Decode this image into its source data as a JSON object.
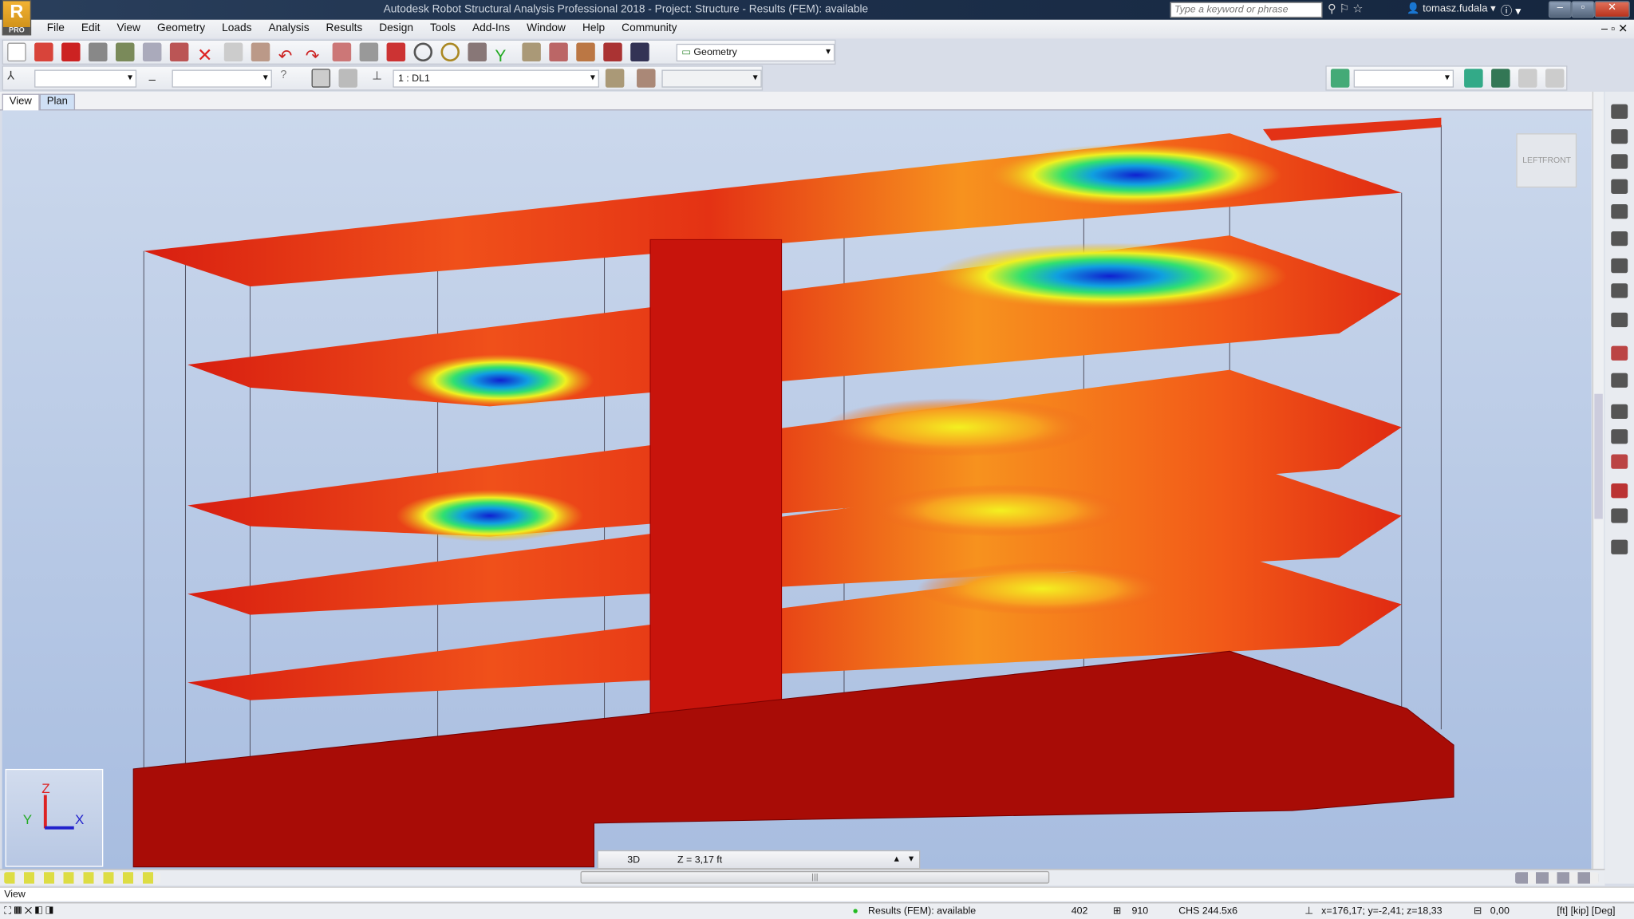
{
  "app": {
    "title": "Autodesk Robot Structural Analysis Professional 2018 - Project: Structure - Results (FEM): available",
    "logo_text": "R",
    "logo_badge": "PRO"
  },
  "search": {
    "placeholder": "Type a keyword or phrase"
  },
  "user": {
    "name": "tomasz.fudala"
  },
  "menu": [
    "File",
    "Edit",
    "View",
    "Geometry",
    "Loads",
    "Analysis",
    "Results",
    "Design",
    "Tools",
    "Add-Ins",
    "Window",
    "Help",
    "Community"
  ],
  "toolbar": {
    "layout_select": "Geometry",
    "load_case": "1 : DL1"
  },
  "tabs": [
    "View",
    "Plan"
  ],
  "viewcube": {
    "left": "LEFT",
    "front": "FRONT"
  },
  "axes": {
    "z": "Z",
    "y": "Y",
    "x": "X"
  },
  "view_controls": {
    "mode": "3D",
    "level": "Z = 3,17 ft"
  },
  "view_line": "View",
  "status": {
    "results": "Results (FEM): available",
    "nodes": "402",
    "bars": "910",
    "section": "CHS 244.5x6",
    "coords": "x=176,17; y=-2,41; z=18,33",
    "angle": "0,00",
    "units": "[ft] [kip] [Deg]"
  },
  "colors": {
    "accent": "#c81a0f",
    "title_bar": "#1c2f4a",
    "viewport": "#b9cbe6"
  }
}
